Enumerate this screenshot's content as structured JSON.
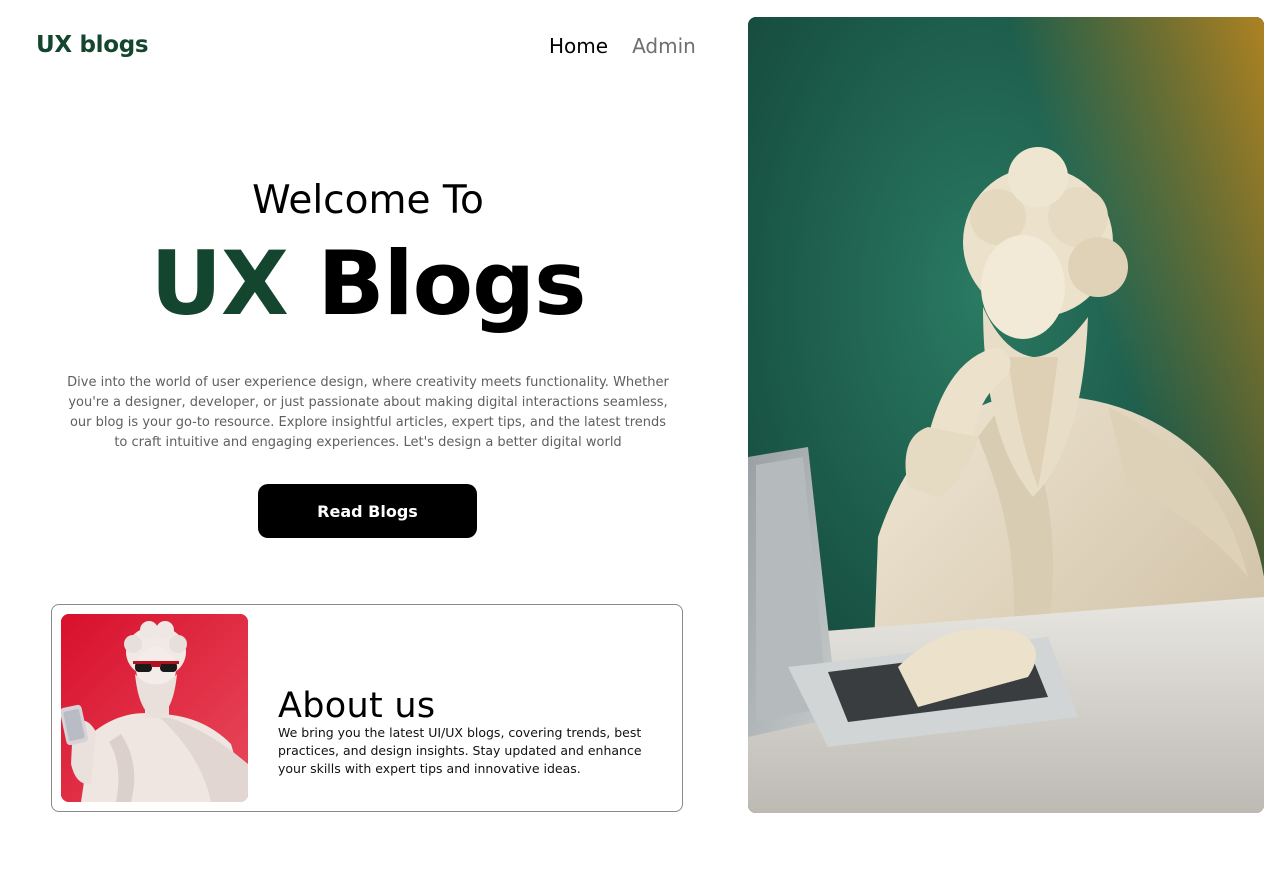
{
  "brand": {
    "name": "UX blogs"
  },
  "nav": {
    "home": "Home",
    "admin": "Admin"
  },
  "hero": {
    "welcome": "Welcome To",
    "title_accent": "UX",
    "title_main": "Blogs",
    "description": "Dive into the world of user experience design, where creativity meets functionality. Whether you're a designer, developer, or just passionate about making digital interactions seamless, our blog is your go-to resource. Explore insightful articles, expert tips, and the latest trends to craft intuitive and engaging experiences. Let's design a better digital world",
    "cta_label": "Read Blogs"
  },
  "about": {
    "title": "About us",
    "text": "We bring you the latest UI/UX blogs, covering trends, best practices, and design insights. Stay updated and enhance your skills with expert tips and innovative ideas."
  },
  "colors": {
    "brand_green": "#14452f",
    "button_bg": "#000000",
    "about_image_bg": "#c8102a",
    "hero_image_bg": "#1e5a4a"
  }
}
